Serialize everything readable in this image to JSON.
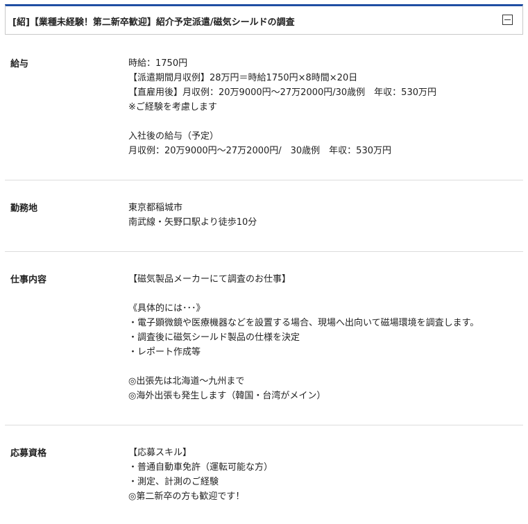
{
  "header": {
    "title": "[紹]【業種未経験！第二新卒歓迎】紹介予定派遣/磁気シールドの調査"
  },
  "sections": [
    {
      "label": "給与",
      "lines": [
        "時給：1750円",
        "【派遣期間月収例】28万円＝時給1750円×8時間×20日",
        "【直雇用後】月収例：20万9000円～27万2000円/30歳例　年収：530万円",
        "※ご経験を考慮します",
        "",
        "入社後の給与（予定）",
        "月収例：20万9000円～27万2000円/　30歳例　年収：530万円"
      ]
    },
    {
      "label": "勤務地",
      "lines": [
        "東京都稲城市",
        "南武線・矢野口駅より徒歩10分"
      ]
    },
    {
      "label": "仕事内容",
      "lines": [
        "【磁気製品メーカーにて調査のお仕事】",
        "",
        "《具体的には･･･》",
        "・電子顕微鏡や医療機器などを設置する場合、現場へ出向いて磁場環境を調査します。",
        "・調査後に磁気シールド製品の仕様を決定",
        "・レポート作成等",
        "",
        "◎出張先は北海道～九州まで",
        "◎海外出張も発生します（韓国・台湾がメイン）"
      ]
    },
    {
      "label": "応募資格",
      "lines": [
        "【応募スキル】",
        "・普通自動車免許（運転可能な方）",
        "・測定、計測のご経験",
        "◎第二新卒の方も歓迎です！"
      ]
    }
  ]
}
